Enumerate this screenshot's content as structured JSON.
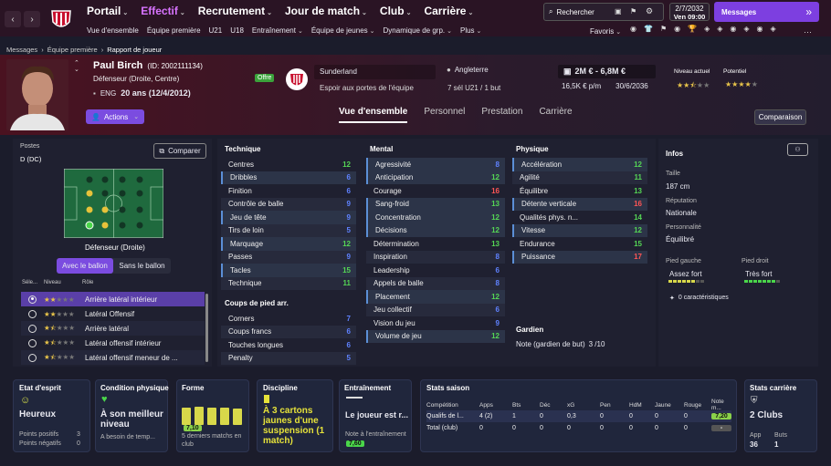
{
  "topbar": {
    "nav": [
      "Portail",
      "Effectif",
      "Recrutement",
      "Jour de match",
      "Club",
      "Carrière"
    ],
    "search_label": "Rechercher",
    "date": "2/7/2032",
    "time": "Ven 09:00",
    "messages_label": "Messages"
  },
  "subbar": {
    "items": [
      "Vue d'ensemble",
      "Équipe première",
      "U21",
      "U18",
      "Entraînement",
      "Équipe de jeunes",
      "Dynamique de grp.",
      "Plus"
    ],
    "favoris": "Favoris"
  },
  "breadcrumb": [
    "Messages",
    "Équipe première",
    "Rapport de joueur"
  ],
  "player": {
    "name": "Paul Birch",
    "id": "(ID: 2002111134)",
    "position": "Défenseur (Droite, Centre)",
    "nationality": "ENG",
    "age": "20 ans (12/4/2012)",
    "offer_badge": "Offre",
    "club": "Sunderland",
    "club_status": "Espoir aux portes de l'équipe",
    "country": "Angleterre",
    "caps": "7 sél U21 / 1 but",
    "value": "2M € - 6,8M €",
    "wage": "16,5K € p/m",
    "contract": "30/6/2036",
    "current_level_label": "Niveau actuel",
    "potential_label": "Potentiel",
    "current_stars": 2.5,
    "potential_stars": 4,
    "actions_label": "Actions"
  },
  "tabs": [
    "Vue d'ensemble",
    "Personnel",
    "Prestation",
    "Carrière"
  ],
  "compare_label": "Comparaison",
  "left_panel": {
    "postes_label": "Postes",
    "poste_value": "D (DC)",
    "compare_btn": "Comparer",
    "pitch_caption": "Défenseur (Droite)",
    "toggle_on": "Avec le ballon",
    "toggle_off": "Sans le ballon",
    "col_sel": "Séle...",
    "col_level": "Niveau",
    "col_role": "Rôle",
    "roles": [
      {
        "name": "Arrière latéral intérieur",
        "stars": 2,
        "selected": true
      },
      {
        "name": "Latéral Offensif",
        "stars": 2,
        "selected": false
      },
      {
        "name": "Arrière latéral",
        "stars": 1.5,
        "selected": false
      },
      {
        "name": "Latéral offensif intérieur",
        "stars": 1.5,
        "selected": false
      },
      {
        "name": "Latéral offensif meneur de ...",
        "stars": 1.5,
        "selected": false
      }
    ]
  },
  "technique": {
    "title": "Technique",
    "rows": [
      [
        "Centres",
        "12",
        "g"
      ],
      [
        "Dribbles",
        "6",
        "b"
      ],
      [
        "Finition",
        "6",
        "b"
      ],
      [
        "Contrôle de balle",
        "9",
        "b"
      ],
      [
        "Jeu de tête",
        "9",
        "b"
      ],
      [
        "Tirs de loin",
        "5",
        "b"
      ],
      [
        "Marquage",
        "12",
        "g"
      ],
      [
        "Passes",
        "9",
        "b"
      ],
      [
        "Tacles",
        "15",
        "g"
      ],
      [
        "Technique",
        "11",
        "g"
      ]
    ]
  },
  "set_pieces": {
    "title": "Coups de pied arr.",
    "rows": [
      [
        "Corners",
        "7",
        "b"
      ],
      [
        "Coups francs",
        "6",
        "b"
      ],
      [
        "Touches longues",
        "6",
        "b"
      ],
      [
        "Penalty",
        "5",
        "b"
      ]
    ]
  },
  "mental": {
    "title": "Mental",
    "rows": [
      [
        "Agressivité",
        "8",
        "b"
      ],
      [
        "Anticipation",
        "12",
        "g"
      ],
      [
        "Courage",
        "16",
        "r"
      ],
      [
        "Sang-froid",
        "13",
        "g"
      ],
      [
        "Concentration",
        "12",
        "g"
      ],
      [
        "Décisions",
        "12",
        "g"
      ],
      [
        "Détermination",
        "13",
        "g"
      ],
      [
        "Inspiration",
        "8",
        "b"
      ],
      [
        "Leadership",
        "6",
        "b"
      ],
      [
        "Appels de balle",
        "8",
        "b"
      ],
      [
        "Placement",
        "12",
        "g"
      ],
      [
        "Jeu collectif",
        "6",
        "b"
      ],
      [
        "Vision du jeu",
        "9",
        "b"
      ],
      [
        "Volume de jeu",
        "12",
        "g"
      ]
    ]
  },
  "physique": {
    "title": "Physique",
    "rows": [
      [
        "Accélération",
        "12",
        "g"
      ],
      [
        "Agilité",
        "11",
        "g"
      ],
      [
        "Équilibre",
        "13",
        "g"
      ],
      [
        "Détente verticale",
        "16",
        "r"
      ],
      [
        "Qualités phys. n...",
        "14",
        "g"
      ],
      [
        "Vitesse",
        "12",
        "g"
      ],
      [
        "Endurance",
        "15",
        "g"
      ],
      [
        "Puissance",
        "17",
        "r"
      ]
    ]
  },
  "gardien": {
    "title": "Gardien",
    "label": "Note (gardien de but)",
    "value": "3 /10"
  },
  "infos": {
    "title": "Infos",
    "taille_label": "Taille",
    "taille": "187 cm",
    "reputation_label": "Réputation",
    "reputation": "Nationale",
    "personnalite_label": "Personnalité",
    "personnalite": "Équilibré",
    "pied_gauche_label": "Pied gauche",
    "pied_gauche": "Assez fort",
    "pied_droit_label": "Pied droit",
    "pied_droit": "Très fort",
    "traits": "0 caractéristiques"
  },
  "cards": {
    "moral": {
      "title": "Etat d'esprit",
      "value": "Heureux",
      "pos_label": "Points positifs",
      "pos": "3",
      "neg_label": "Points négatifs",
      "neg": "0"
    },
    "condition": {
      "title": "Condition physique",
      "value": "À son meilleur niveau",
      "sub": "A besoin de temp..."
    },
    "forme": {
      "title": "Forme",
      "note": "7,10",
      "sub": "5 derniers matchs en club",
      "bars": [
        0.62,
        0.66,
        0.62,
        0.62,
        0.6
      ]
    },
    "discipline": {
      "title": "Discipline",
      "value": "À 3 cartons jaunes d'une suspension (1 match)"
    },
    "training": {
      "title": "Entraînement",
      "value": "Le joueur est r...",
      "note_label": "Note à l'entraînement",
      "note": "7,60"
    },
    "season": {
      "title": "Stats saison",
      "headers": [
        "Compétition",
        "Apps",
        "Bts",
        "Déc",
        "xG",
        "Pen",
        "HdM",
        "Jaune",
        "Rouge",
        "Note m..."
      ],
      "rows": [
        [
          "Qualifs de l...",
          "4 (2)",
          "1",
          "0",
          "0,3",
          "0",
          "0",
          "0",
          "0",
          "7,20"
        ],
        [
          "Total (club)",
          "0",
          "0",
          "0",
          "0",
          "0",
          "0",
          "0",
          "0",
          "-"
        ]
      ]
    },
    "career": {
      "title": "Stats carrière",
      "value": "2 Clubs",
      "app_label": "App",
      "app": "36",
      "buts_label": "Buts",
      "buts": "1"
    }
  },
  "colors": {
    "accent": "#7b4ce0",
    "green": "#55d655",
    "blue": "#5f82ff",
    "red": "#ff5555",
    "gold": "#e8c44a"
  }
}
